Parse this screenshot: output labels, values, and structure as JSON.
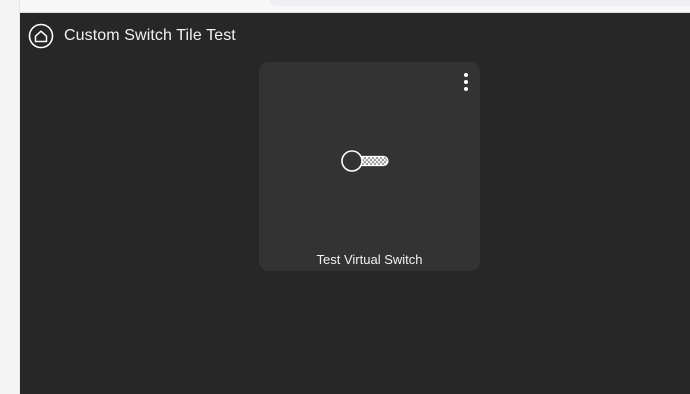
{
  "dashboard": {
    "title": "Custom Switch Tile Test",
    "header_icon": "home-icon"
  },
  "tiles": [
    {
      "label": "Test Virtual Switch",
      "icon": "toggle-switch-icon",
      "state": "off",
      "menu_icon": "more-vertical-icon"
    }
  ],
  "colors": {
    "background": "#272727",
    "tile_background": "#333333",
    "text": "#f2f2f2",
    "icon": "#ffffff"
  }
}
